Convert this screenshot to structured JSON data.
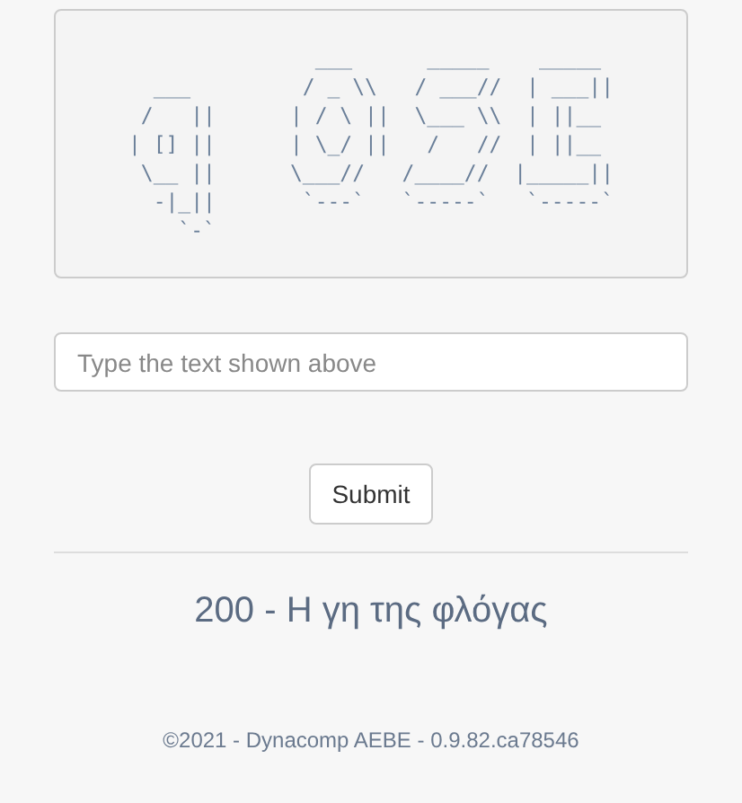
{
  "captcha": {
    "lines": [
      "               ___      _____    _____",
      "  ___         / _ \\\\   / ___//  | ___||",
      " /   ||      | / \\ ||  \\___ \\\\  | ||__",
      "| [] ||      | \\_/ ||   /   //  | ||__",
      " \\__ ||      \\___//   /____//  |_____||",
      "  -|_||       `---`   `-----`   `-----`",
      "    `-`"
    ]
  },
  "answer": {
    "placeholder": "Type the text shown above"
  },
  "submit": {
    "label": "Submit"
  },
  "status_message": "200 - Η γη της φλόγας",
  "footer": "©2021 - Dynacomp AEBE - 0.9.82.ca78546"
}
